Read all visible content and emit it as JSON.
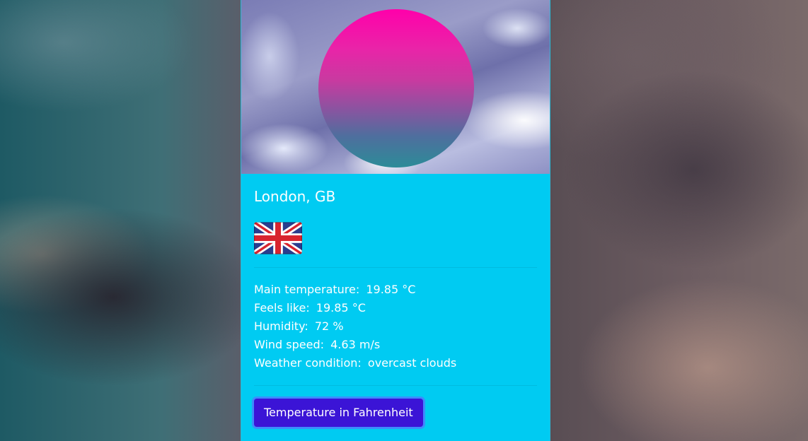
{
  "location": {
    "city_country": "London, GB"
  },
  "flag_icon": "uk-flag-icon",
  "weather": {
    "main_temperature": {
      "label": "Main temperature:",
      "value": "19.85 °C"
    },
    "feels_like": {
      "label": "Feels like:",
      "value": "19.85 °C"
    },
    "humidity": {
      "label": "Humidity:",
      "value": "72 %"
    },
    "wind_speed": {
      "label": "Wind speed:",
      "value": "4.63 m/s"
    },
    "condition": {
      "label": "Weather condition:",
      "value": "overcast clouds"
    }
  },
  "actions": {
    "toggle_unit_label": "Temperature in Fahrenheit"
  },
  "colors": {
    "card_background": "#00cbf2",
    "button_background": "#3b14d6",
    "button_focus_ring": "#3d8bfd"
  }
}
